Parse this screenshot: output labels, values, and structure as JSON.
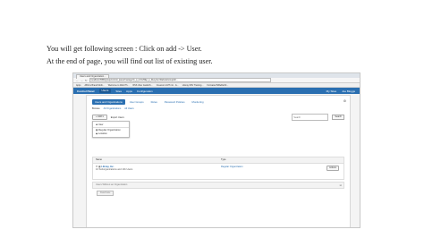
{
  "captions": {
    "line1": "You will get following screen : Click on add -> User.",
    "line2": "At the end of page, you will find out list of existing user."
  },
  "browser": {
    "tab_title": "Users and Organization...",
    "url": "localhost:8080/group/control_panel/manage?p_p_id=125&p_p_lifecycle=0&doAsGroupId=...",
    "bookmarks": [
      "Apps",
      "Affirms Brand Mobi...",
      "Welcome to Web Ph...",
      "RSS Uber GuideTo...",
      "Creacom LMT mit - G...",
      "Liferay 6DV Training...",
      "FormatterToBeRefUt..."
    ]
  },
  "dock": {
    "title": "Control Panel",
    "items": [
      "Users",
      "Sites",
      "Apps",
      "Configuration"
    ],
    "right_items": [
      "My Sites",
      "Joe Bloggs"
    ]
  },
  "panel": {
    "tabs": [
      "Users and Organizations",
      "User Groups",
      "Roles",
      "Password Policies",
      "Monitoring"
    ],
    "active_tab": 0,
    "subtabs": [
      "Browse",
      "All Organizations",
      "All Users"
    ],
    "add_button": "Add",
    "export_label": "Export Users",
    "search_placeholder": "Search",
    "search_button": "Search",
    "add_menu": [
      "User",
      "Regular Organization",
      "Location"
    ],
    "table_header_name": "Name",
    "table_header_type": "Type",
    "org": {
      "name": "Liferay, Inc.",
      "subtitle": "10 Suborganizations and 101 Users",
      "type": "Regular Organization",
      "actions_label": "Actions"
    },
    "users_section": "Users Without an Organization",
    "deactivate_label": "Deactivate"
  }
}
